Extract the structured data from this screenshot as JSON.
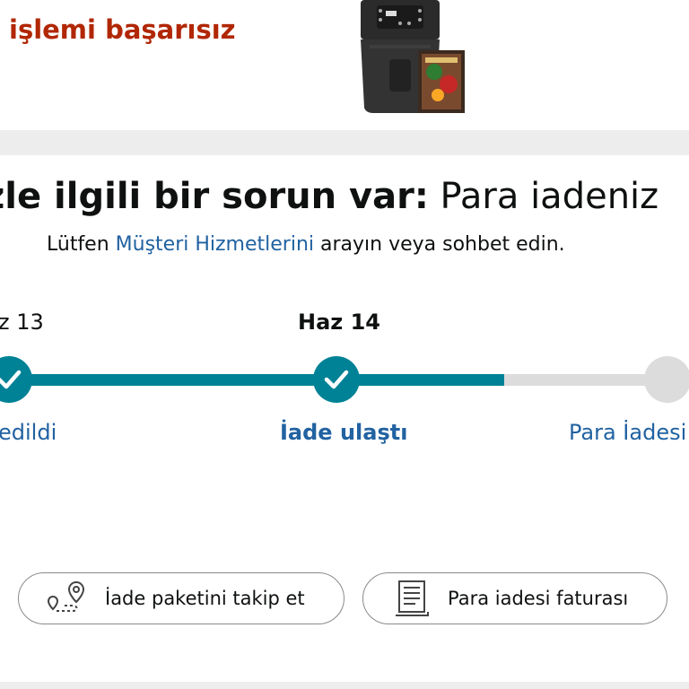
{
  "header": {
    "status_title": "işlemi başarısız"
  },
  "product": {
    "image": "air-fryer-with-recipe-book"
  },
  "notice": {
    "headline_bold": "zle ilgili bir sorun var:",
    "headline_rest": " Para iadeniz",
    "sub_before": "Lütfen ",
    "sub_link": "Müşteri Hizmetlerini",
    "sub_after": " arayın veya sohbet edin."
  },
  "timeline": {
    "steps": [
      {
        "date": "z 13",
        "label": "edildi",
        "status": "completed"
      },
      {
        "date": "Haz 14",
        "label": "İade ulaştı",
        "status": "current"
      },
      {
        "date": "",
        "label": "Para İadesi",
        "status": "pending"
      }
    ],
    "colors": {
      "completed": "#008296",
      "pending": "#dcdcdc",
      "link": "#2162a1"
    }
  },
  "actions": {
    "track_label": "İade paketini takip et",
    "track_icon": "map-route-icon",
    "invoice_label": "Para iadesi faturası",
    "invoice_icon": "document-icon"
  },
  "colors": {
    "error": "#b12704",
    "accent": "#008296"
  }
}
